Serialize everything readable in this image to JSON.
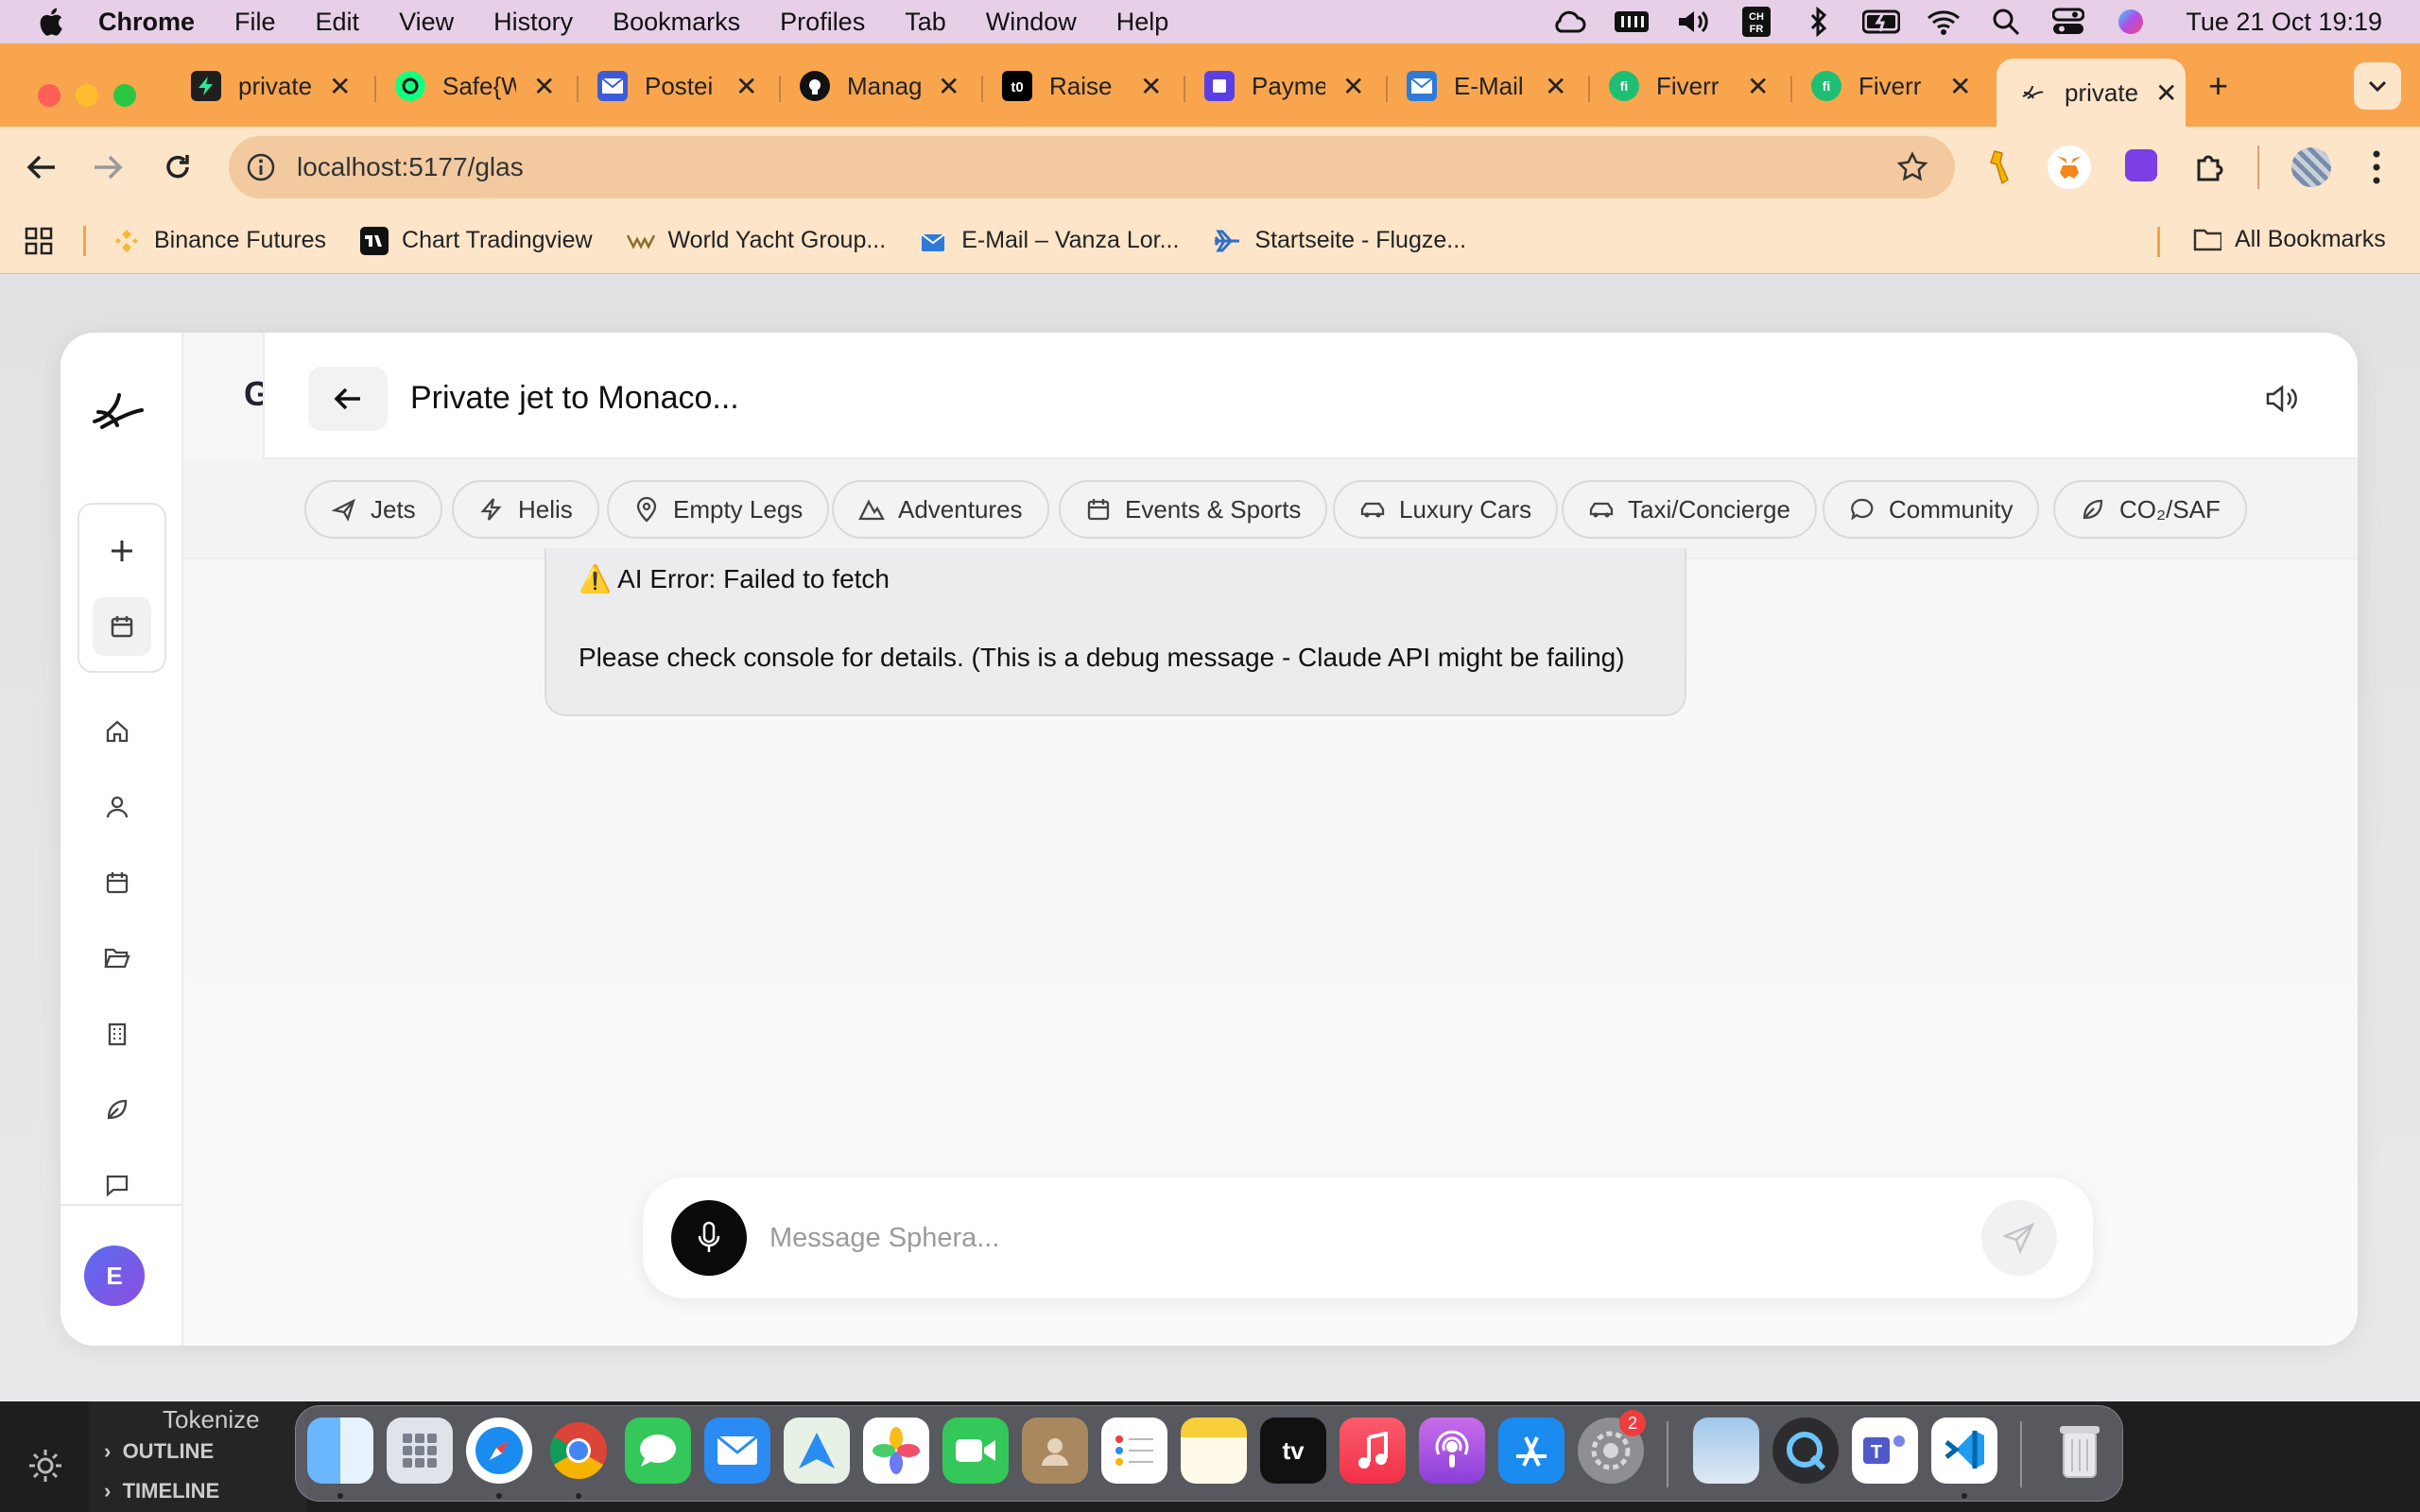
{
  "menubar": {
    "app": "Chrome",
    "items": [
      "File",
      "Edit",
      "View",
      "History",
      "Bookmarks",
      "Profiles",
      "Tab",
      "Window",
      "Help"
    ],
    "clock": "Tue 21 Oct  19:19",
    "keyboard_badge": "CH FR"
  },
  "tabs": [
    {
      "label": "private",
      "favicon": "bolt-icon",
      "color": "#1f1f1f"
    },
    {
      "label": "Safe{W",
      "favicon": "safe-icon",
      "color": "#12ff80"
    },
    {
      "label": "Postei",
      "favicon": "mail-icon",
      "color": "#3b5bdb"
    },
    {
      "label": "Manag",
      "favicon": "github-icon",
      "color": "#111111"
    },
    {
      "label": "Raise",
      "favicon": "t0-icon",
      "color": "#000000"
    },
    {
      "label": "Payme",
      "favicon": "payment-icon",
      "color": "#5b3fe4"
    },
    {
      "label": "E-Mail",
      "favicon": "mail-icon",
      "color": "#2f7ad8"
    },
    {
      "label": "Fiverr",
      "favicon": "fiverr-icon",
      "color": "#1dbf73"
    },
    {
      "label": "Fiverr",
      "favicon": "fiverr-icon",
      "color": "#1dbf73"
    },
    {
      "label": "private",
      "favicon": "brand-icon",
      "color": "#222222",
      "active": true
    }
  ],
  "toolbar": {
    "url": "localhost:5177/glas"
  },
  "bookmarks": [
    {
      "label": "Binance Futures",
      "icon": "binance-icon"
    },
    {
      "label": "Chart Tradingview",
      "icon": "tradingview-icon"
    },
    {
      "label": "World Yacht Group...",
      "icon": "wyg-icon"
    },
    {
      "label": "E-Mail – Vanza Lor...",
      "icon": "mail-icon"
    },
    {
      "label": "Startseite - Flugze...",
      "icon": "plane-icon"
    }
  ],
  "all_bookmarks": "All Bookmarks",
  "app": {
    "header_letter": "G",
    "chat_title": "Private jet to Monaco...",
    "avatar_letter": "E",
    "chips": [
      {
        "label": "Jets",
        "icon": "plane-icon"
      },
      {
        "label": "Helis",
        "icon": "lightning-icon"
      },
      {
        "label": "Empty Legs",
        "icon": "map-pin-icon"
      },
      {
        "label": "Adventures",
        "icon": "mountain-icon"
      },
      {
        "label": "Events & Sports",
        "icon": "calendar-icon"
      },
      {
        "label": "Luxury Cars",
        "icon": "car-icon"
      },
      {
        "label": "Taxi/Concierge",
        "icon": "taxi-icon"
      },
      {
        "label": "Community",
        "icon": "chat-bubble-icon"
      },
      {
        "label": "CO₂/SAF",
        "icon": "leaf-icon"
      }
    ],
    "message": {
      "error_line": "⚠️ AI Error: Failed to fetch",
      "detail_line": "Please check console for details. (This is a debug message - Claude API might be failing)"
    },
    "composer": {
      "placeholder": "Message Sphera..."
    }
  },
  "vscode": {
    "tokenize": "Tokenize",
    "outline": "OUTLINE",
    "timeline": "TIMELINE"
  },
  "dock": {
    "settings_badge": "2"
  }
}
